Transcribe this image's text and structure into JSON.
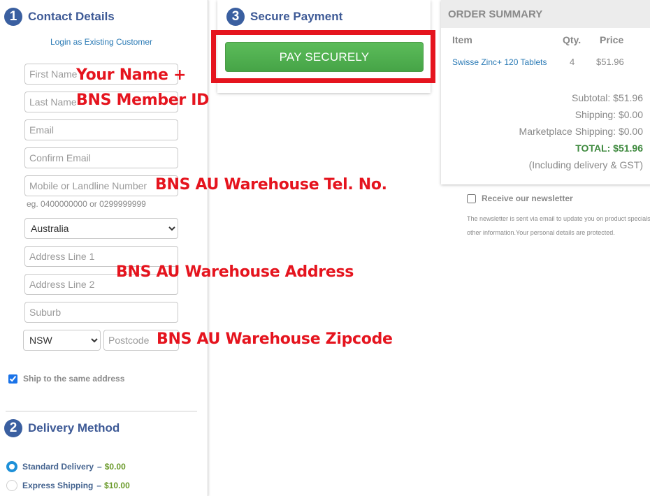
{
  "contact": {
    "step_number": "1",
    "title": "Contact Details",
    "login_link": "Login as Existing Customer",
    "fields": {
      "first_name_placeholder": "First Name",
      "last_name_placeholder": "Last Name",
      "email_placeholder": "Email",
      "confirm_email_placeholder": "Confirm Email",
      "phone_placeholder": "Mobile or Landline Number",
      "phone_hint": "eg. 0400000000 or 0299999999",
      "country_value": "Australia",
      "address1_placeholder": "Address Line 1",
      "address2_placeholder": "Address Line 2",
      "suburb_placeholder": "Suburb",
      "state_value": "NSW",
      "postcode_placeholder": "Postcode"
    },
    "ship_same_label": "Ship to the same address",
    "ship_same_checked": true
  },
  "delivery": {
    "step_number": "2",
    "title": "Delivery Method",
    "options": [
      {
        "label": "Standard Delivery",
        "price": "$0.00",
        "selected": true
      },
      {
        "label": "Express Shipping",
        "price": "$10.00",
        "selected": false
      }
    ],
    "dash": "–"
  },
  "payment": {
    "step_number": "3",
    "title": "Secure Payment",
    "button_label": "PAY SECURELY"
  },
  "summary": {
    "title": "ORDER SUMMARY",
    "columns": [
      "Item",
      "Qty.",
      "Price"
    ],
    "items": [
      {
        "name": "Swisse Zinc+ 120 Tablets",
        "qty": "4",
        "price": "$51.96"
      }
    ],
    "subtotal": "Subtotal: $51.96",
    "shipping": "Shipping: $0.00",
    "marketplace_shipping": "Marketplace Shipping: $0.00",
    "total": "TOTAL: $51.96",
    "note": "(Including delivery & GST)"
  },
  "newsletter": {
    "label": "Receive our newsletter",
    "checked": false,
    "note_line1": "The newsletter is sent via email to update you on product specials and",
    "note_line2": "other information.Your personal details are protected."
  },
  "annotations": {
    "name_line1": "Your Name +",
    "name_line2": "BNS Member ID",
    "phone": "BNS AU Warehouse Tel. No.",
    "address": "BNS AU Warehouse Address",
    "zipcode": "BNS AU Warehouse Zipcode",
    "highlight_color": "#e5141e"
  },
  "colors": {
    "step_badge": "#3a5fa0",
    "heading": "#3e5a96",
    "link": "#2a7ab5",
    "pay_button": "#50b050",
    "total_green": "#3f8a3f"
  }
}
